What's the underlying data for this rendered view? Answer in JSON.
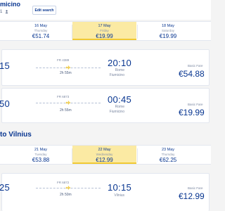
{
  "header": {
    "route_title": "micino",
    "passengers": "1",
    "edit_label": "Edit search"
  },
  "outbound_dates": [
    {
      "date": "16 May",
      "weekday": "Thursday",
      "price": "€51.74",
      "selected": false
    },
    {
      "date": "17 May",
      "weekday": "Friday",
      "price": "€19.99",
      "selected": true
    },
    {
      "date": "18 May",
      "weekday": "Saturday",
      "price": "€19.99",
      "selected": false
    }
  ],
  "outbound_flights": [
    {
      "depart_time": "15",
      "flight_no": "FR 4389",
      "duration": "2h 55m",
      "arrive_time": "20:10",
      "city_1": "Rome",
      "city_2": "Fiumicino",
      "fare_label": "Basic Fare",
      "fare": "€54.88"
    },
    {
      "depart_time": "50",
      "flight_no": "FR 6873",
      "duration": "2h 55m",
      "arrive_time": "00:45",
      "city_1": "Rome",
      "city_2": "Fiumicino",
      "fare_label": "Basic Fare",
      "fare": "€19.99"
    }
  ],
  "return_section": {
    "title": "to Vilnius"
  },
  "return_dates": [
    {
      "date": "21 May",
      "weekday": "Tuesday",
      "price": "€53.88",
      "selected": false
    },
    {
      "date": "22 May",
      "weekday": "Wednesday",
      "price": "€12.99",
      "selected": true
    },
    {
      "date": "23 May",
      "weekday": "Thursday",
      "price": "€62.25",
      "selected": false
    }
  ],
  "return_flights": [
    {
      "depart_time": "25",
      "flight_no": "FR 6872",
      "duration": "2h 50m",
      "arrive_time": "10:15",
      "city_1": "Vilnius",
      "fare_label": "Basic Fare",
      "fare": "€12.99"
    }
  ],
  "colors": {
    "brand_navy": "#073590",
    "selected_yellow": "#fbeaa3",
    "accent_yellow": "#f1c933"
  },
  "icons": {
    "person": "person-icon",
    "plane": "plane-icon"
  }
}
